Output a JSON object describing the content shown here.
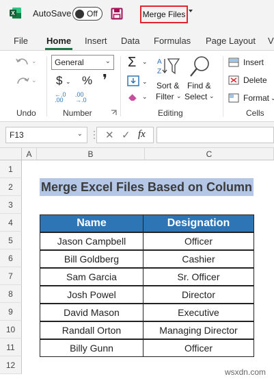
{
  "titlebar": {
    "autosave_label": "AutoSave",
    "autosave_state": "Off",
    "document_title": "Merge Files"
  },
  "tabs": [
    "File",
    "Home",
    "Insert",
    "Data",
    "Formulas",
    "Page Layout",
    "View"
  ],
  "active_tab": "Home",
  "ribbon": {
    "undo_group": "Undo",
    "number_group": "Number",
    "number_format": "General",
    "editing_group": "Editing",
    "sort_filter_line1": "Sort &",
    "sort_filter_line2": "Filter",
    "find_select_line1": "Find &",
    "find_select_line2": "Select",
    "cells_group": "Cells",
    "insert_label": "Insert",
    "delete_label": "Delete",
    "format_label": "Format"
  },
  "formula_bar": {
    "name_box": "F13",
    "fx_symbol": "fx",
    "formula": ""
  },
  "columns": [
    "A",
    "B",
    "C"
  ],
  "rows": [
    "1",
    "2",
    "3",
    "4",
    "5",
    "6",
    "7",
    "8",
    "9",
    "10",
    "11",
    "12"
  ],
  "sheet": {
    "title": "Merge Excel Files Based on Column",
    "headers": [
      "Name",
      "Designation"
    ],
    "records": [
      [
        "Jason Campbell",
        "Officer"
      ],
      [
        "Bill Goldberg",
        "Cashier"
      ],
      [
        "Sam Garcia",
        "Sr. Officer"
      ],
      [
        "Josh Powel",
        "Director"
      ],
      [
        "David Mason",
        "Executive"
      ],
      [
        "Randall Orton",
        "Managing Director"
      ],
      [
        "Billy Gunn",
        "Officer"
      ]
    ]
  },
  "watermark": "wsxdn.com",
  "colors": {
    "excel_green": "#217346",
    "header_blue": "#2e75b6",
    "title_fill": "#b4c7e7",
    "highlight_red": "#e3262e"
  }
}
